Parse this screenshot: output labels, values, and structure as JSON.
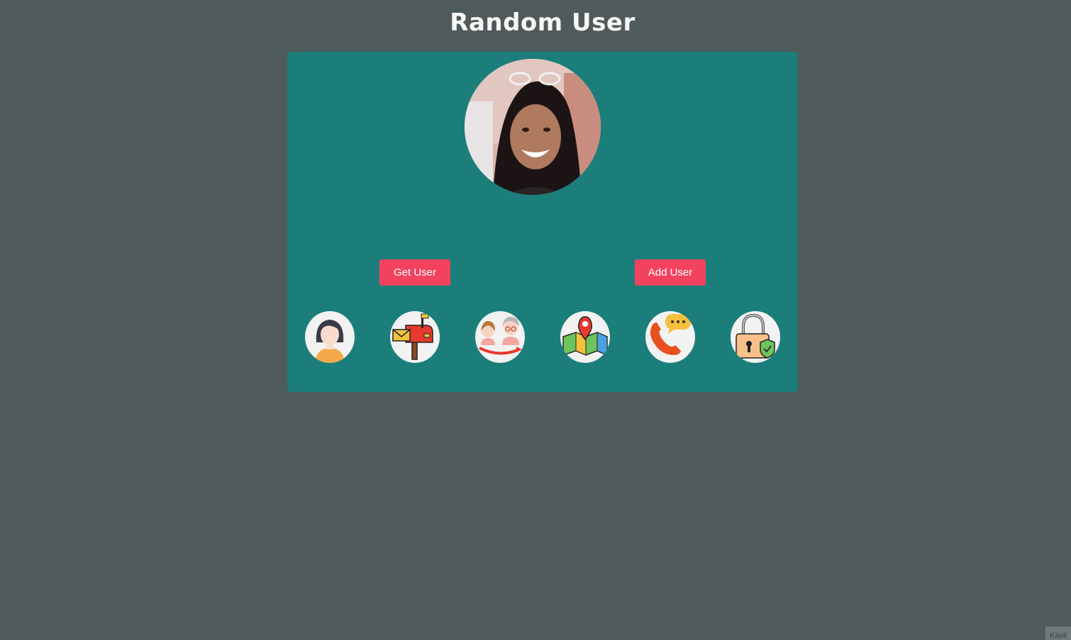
{
  "page": {
    "title": "Random User"
  },
  "profile": {
    "photo_alt": "user photo"
  },
  "actions": {
    "get_user_label": "Get User",
    "add_user_label": "Add User"
  },
  "info_icons": [
    {
      "name": "user-icon"
    },
    {
      "name": "mailbox-icon"
    },
    {
      "name": "age-icon"
    },
    {
      "name": "map-location-icon"
    },
    {
      "name": "phone-icon"
    },
    {
      "name": "password-lock-icon"
    }
  ],
  "footer": {
    "badge_text": "Kavit"
  },
  "colors": {
    "background": "#4f5a5a",
    "card": "#1b7e7a",
    "button": "#f3425f",
    "title": "#f6f6f6"
  }
}
